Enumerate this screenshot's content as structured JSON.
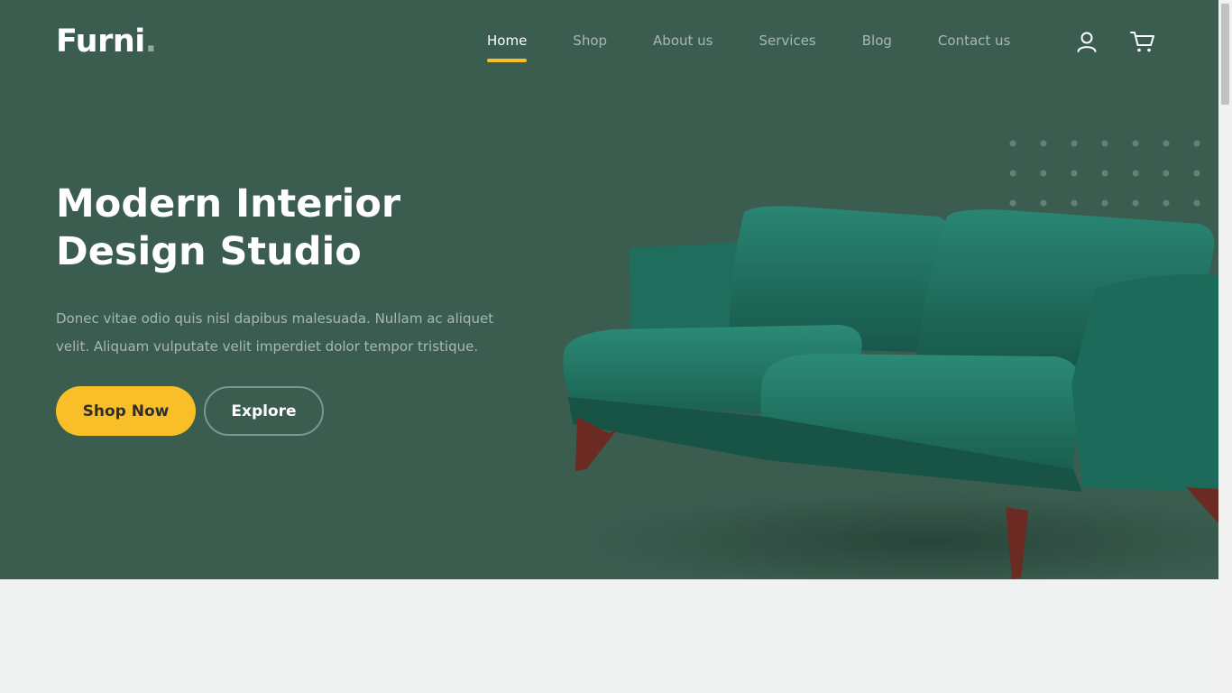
{
  "brand": {
    "name": "Furni",
    "dot": "."
  },
  "nav": {
    "items": [
      {
        "label": "Home",
        "active": true
      },
      {
        "label": "Shop",
        "active": false
      },
      {
        "label": "About us",
        "active": false
      },
      {
        "label": "Services",
        "active": false
      },
      {
        "label": "Blog",
        "active": false
      },
      {
        "label": "Contact us",
        "active": false
      }
    ],
    "icons": [
      "user-icon",
      "cart-icon"
    ]
  },
  "hero": {
    "title": "Modern Interior Design Studio",
    "description": "Donec vitae odio quis nisl dapibus malesuada. Nullam ac aliquet velit. Aliquam vulputate velit imperdiet dolor tempor tristique.",
    "primary_button": "Shop Now",
    "secondary_button": "Explore",
    "image": "green-velvet-sofa"
  },
  "colors": {
    "hero_bg": "#3b5d50",
    "accent": "#f9bf29",
    "page_bg": "#eff2f1",
    "sofa": "#1f6b5a"
  }
}
